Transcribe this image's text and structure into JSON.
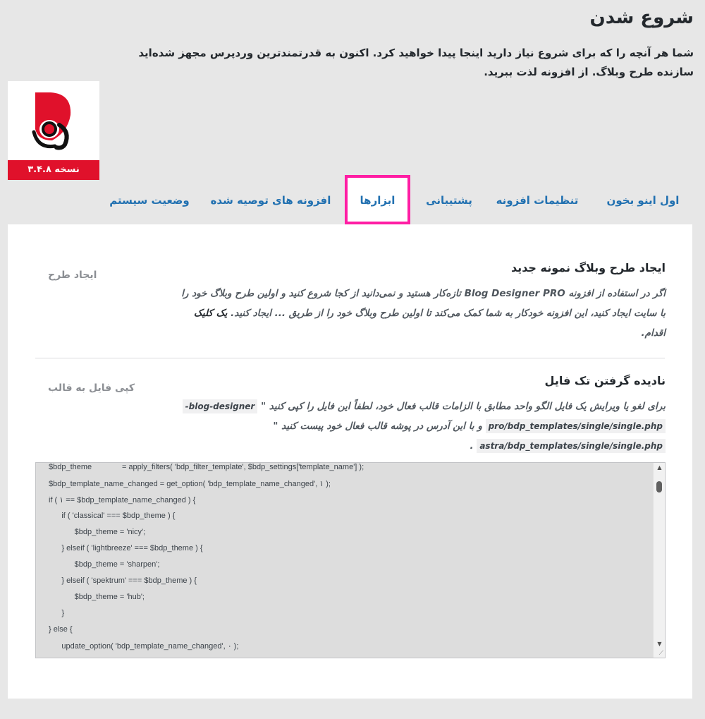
{
  "header": {
    "title": "شروع شدن",
    "intro_text": "شما هر آنچه را که برای شروع نیاز دارید اینجا پیدا خواهید کرد. اکنون به قدرتمندترین وردپرس مجهز شده‌اید",
    "intro_strong": "سازنده طرح وبلاگ",
    "intro_tail": ". از افزونه لذت ببرید."
  },
  "logo": {
    "version_label": "نسخه ۳.۴.۸",
    "brand_color": "#e0112b",
    "icon": "blog-designer-logo-icon"
  },
  "tabs": [
    {
      "label": "اول اینو بخون",
      "active": false
    },
    {
      "label": "تنظیمات افزونه",
      "active": false
    },
    {
      "label": "پشتیبانی",
      "active": false
    },
    {
      "label": "ابزارها",
      "active": true
    },
    {
      "label": "افزونه های توصیه شده",
      "active": false
    },
    {
      "label": "وضعیت سیستم",
      "active": false
    }
  ],
  "create_section": {
    "label": "ایجاد طرح",
    "title": "ایجاد طرح وبلاگ نمونه جدید",
    "desc_1": "اگر در استفاده از افزونه Blog Designer PRO تازه‌کار هستید و نمی‌دانید از کجا شروع کنید و اولین طرح وبلاگ خود را با سایت ایجاد کنید، این افزونه خودکار به شما کمک می‌کند تا اولین طرح وبلاگ خود را از طریق ... ایجاد کنید.",
    "desc_bold": "یک کلیک",
    "desc_2": "اقدام."
  },
  "copy_section": {
    "label": "کپی فایل به قالب",
    "title": "نادیده گرفتن تک فایل",
    "desc": "برای لغو یا ویرایش یک فایل الگو واحد مطابق با الزامات قالب فعال خود، لطفاً این فایل را کپی کنید \"",
    "path_1a": "blog-designer-",
    "path_1b": "pro/bdp_templates/single/single.php",
    "path_mid": "\" و با این آدرس در پوشه قالب فعال خود پیست کنید",
    "path_2": "astra/bdp_templates/single/single.php",
    "path_end": "."
  },
  "code_lines": [
    "$bdp_theme              = apply_filters( 'bdp_filter_template', $bdp_settings['template_name'] );",
    "$bdp_template_name_changed = get_option( 'bdp_template_name_changed', ۱ );",
    "if ( ۱ == $bdp_template_name_changed ) {",
    "      if ( 'classical' === $bdp_theme ) {",
    "            $bdp_theme = 'nicy';",
    "      } elseif ( 'lightbreeze' === $bdp_theme ) {",
    "            $bdp_theme = 'sharpen';",
    "      } elseif ( 'spektrum' === $bdp_theme ) {",
    "            $bdp_theme = 'hub';",
    "      }",
    "} else {",
    "      update_option( 'bdp_template_name_changed', ۰ );"
  ],
  "colors": {
    "accent": "#2271b1",
    "active_tab_border": "#ff1ea4"
  }
}
